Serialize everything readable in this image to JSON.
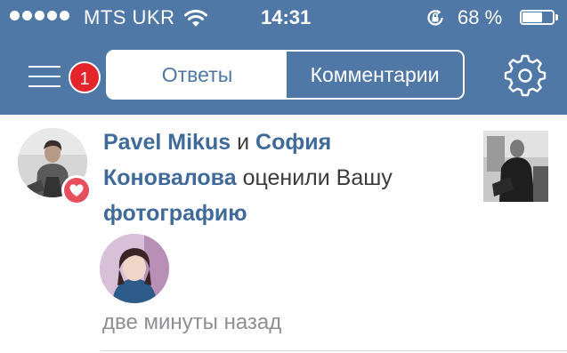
{
  "status_bar": {
    "carrier": "MTS UKR",
    "time": "14:31",
    "battery_percent": "68 %",
    "battery_level": 0.68,
    "signal_bars": 5,
    "icons": [
      "wifi-icon",
      "rotation-lock-icon",
      "battery-icon"
    ]
  },
  "nav": {
    "menu_badge": "1",
    "tabs": [
      {
        "label": "Ответы",
        "selected": false
      },
      {
        "label": "Комментарии",
        "selected": true
      }
    ],
    "icons": [
      "menu-icon",
      "gear-icon"
    ]
  },
  "notification": {
    "actor_1": "Pavel Mikus",
    "conjunction": "и",
    "actor_2": "София Коновалова",
    "action_text": "оценили Вашу",
    "object_text": "фотографию",
    "timestamp": "две минуты назад",
    "badge_icon": "heart-icon"
  },
  "colors": {
    "header_blue": "#4f78a6",
    "link_blue": "#3f6a99",
    "badge_red": "#e3242b",
    "like_red": "#e84f5d",
    "timestamp_gray": "#8e8e93"
  }
}
